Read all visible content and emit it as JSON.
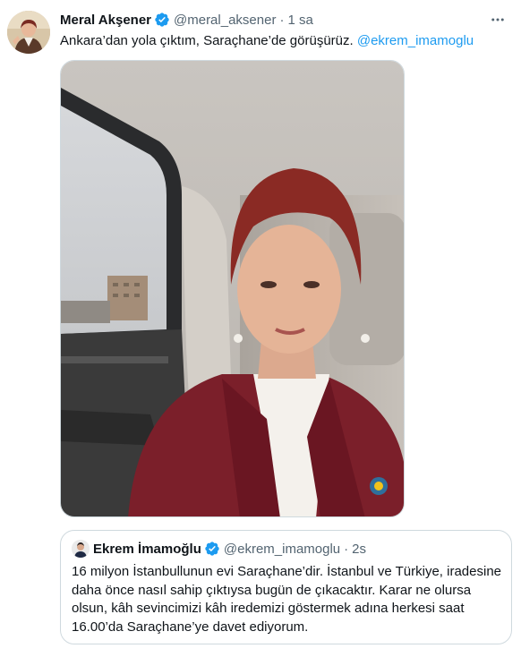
{
  "tweet": {
    "author_name": "Meral Akşener",
    "author_handle": "@meral_aksener",
    "separator": "·",
    "time": "1 sa",
    "text_before_mention": "Ankara’dan yola çıktım, Saraçhane’de görüşürüz. ",
    "mention": "@ekrem_imamoglu",
    "more_icon": "ellipsis-icon",
    "verified_icon": "verified-badge-icon",
    "accent_color": "#1d9bf0"
  },
  "quoted_tweet": {
    "author_name": "Ekrem İmamoğlu",
    "author_handle": "@ekrem_imamoglu",
    "separator": "·",
    "time": "2s",
    "text_lines": [
      "16 milyon İstanbullunun evi Saraçhane’dir. İstanbul ve Türkiye, iradesine",
      "daha önce nasıl sahip çıktıysa bugün de çıkacaktır. Karar ne olursa",
      "olsun, kâh sevincimizi kâh iredemizi göstermek adına herkesi saat",
      "16.00’da Saraçhane’ye davet ediyorum."
    ]
  }
}
